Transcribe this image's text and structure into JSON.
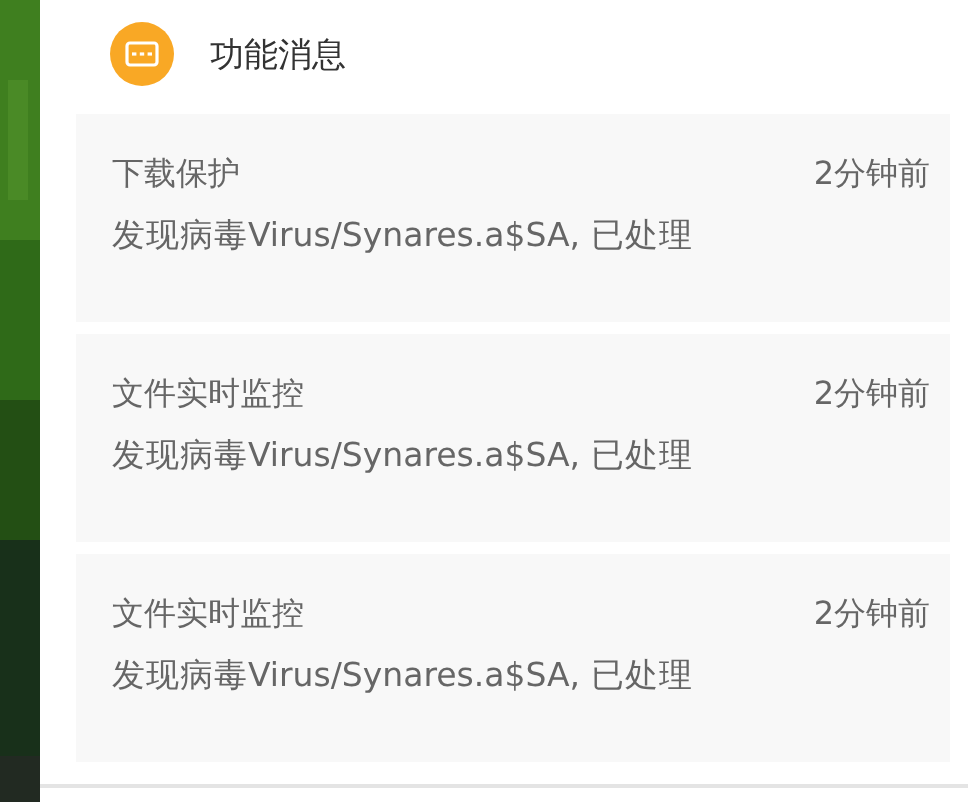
{
  "header": {
    "title": "功能消息"
  },
  "messages": [
    {
      "title": "下载保护",
      "time": "2分钟前",
      "text": "发现病毒Virus/Synares.a$SA, 已处理"
    },
    {
      "title": "文件实时监控",
      "time": "2分钟前",
      "text": "发现病毒Virus/Synares.a$SA, 已处理"
    },
    {
      "title": "文件实时监控",
      "time": "2分钟前",
      "text": "发现病毒Virus/Synares.a$SA, 已处理"
    }
  ]
}
